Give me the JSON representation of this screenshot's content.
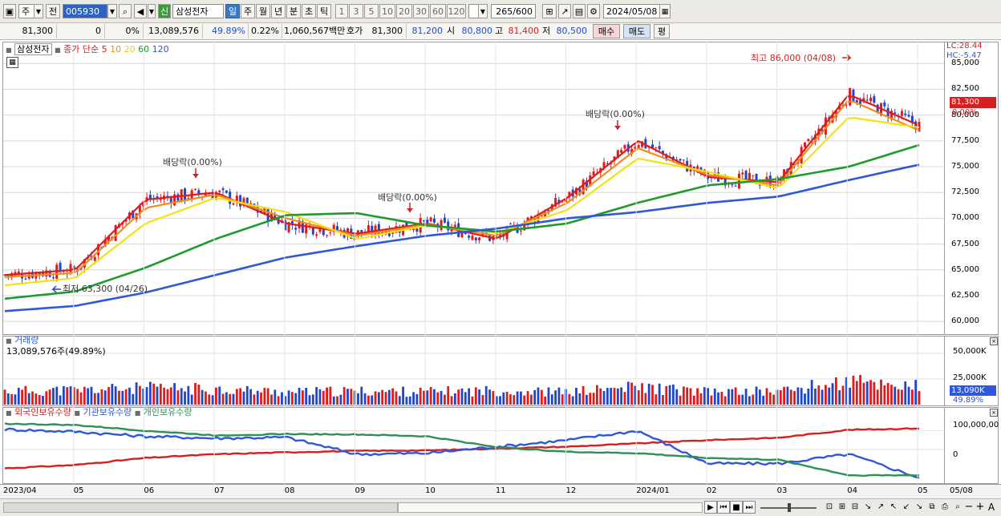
{
  "toolbar": {
    "period_type": "주",
    "prev_label": "전",
    "stock_code": "005930",
    "stock_name": "삼성전자",
    "new_badge": "신",
    "timeframes": [
      "일",
      "주",
      "월",
      "년",
      "분",
      "초",
      "틱"
    ],
    "active_timeframe": "일",
    "intervals": [
      "1",
      "3",
      "5",
      "10",
      "20",
      "30",
      "60",
      "120"
    ],
    "count_current": "265",
    "count_total": "/600",
    "date": "2024/05/08"
  },
  "quote": {
    "price": "81,300",
    "change": "0",
    "change_pct": "0%",
    "volume": "13,089,576",
    "volume_ratio": "49.89%",
    "turnover_pct": "0.22%",
    "amount": "1,060,567백만",
    "ask_label": "호가",
    "ask": "81,300",
    "bid": "81,200",
    "open_label": "시",
    "open": "80,800",
    "high_label": "고",
    "high": "81,400",
    "low_label": "저",
    "low": "80,500",
    "buy_label": "매수",
    "sell_label": "매도",
    "eval_label": "평"
  },
  "legend": {
    "title": "삼성전자",
    "indicator": "종가 단순",
    "periods": [
      {
        "label": "5",
        "color": "#e01b1b"
      },
      {
        "label": "10",
        "color": "#f08c1e"
      },
      {
        "label": "20",
        "color": "#f2e20f"
      },
      {
        "label": "60",
        "color": "#1f9a2d"
      },
      {
        "label": "120",
        "color": "#2f57d9"
      }
    ],
    "lc": "LC:28.44",
    "hc": "HC:-5.47"
  },
  "annotations": {
    "high": "최고 86,000 (04/08)",
    "low": "최저 63,300 (04/26)",
    "dividend": [
      "배당락(0.00%)",
      "배당락(0.00%)",
      "배당락(0.00%)"
    ]
  },
  "price_axis": {
    "ticks": [
      "85,000",
      "82,500",
      "80,000",
      "77,500",
      "75,000",
      "72,500",
      "70,000",
      "67,500",
      "65,000",
      "62,500",
      "60,000"
    ],
    "current_price": "81,300",
    "current_pct": "0.00%"
  },
  "volume_panel": {
    "title": "거래량",
    "value_label": "13,089,576주(49.89%)",
    "ticks": [
      "50,000K",
      "25,000K"
    ],
    "current": "13,090K",
    "current_pct": "49.89%"
  },
  "holdings_panel": {
    "series": [
      {
        "label": "외국인보유수량",
        "color": "#d42020"
      },
      {
        "label": "기관보유수량",
        "color": "#2f57d9"
      },
      {
        "label": "개인보유수량",
        "color": "#2f8f5a"
      }
    ],
    "ticks": [
      "100,000,00",
      "0"
    ]
  },
  "date_axis": [
    "2023/04",
    "05",
    "06",
    "07",
    "08",
    "09",
    "10",
    "11",
    "12",
    "2024/01",
    "02",
    "03",
    "04",
    "05",
    "05/08"
  ],
  "chart_data": [
    {
      "type": "line",
      "title": "삼성전자",
      "xlabel": "",
      "ylabel": "",
      "x": [
        "2023/04",
        "05",
        "06",
        "07",
        "08",
        "09",
        "10",
        "11",
        "12",
        "2024/01",
        "02",
        "03",
        "04",
        "05"
      ],
      "ylim": [
        59000,
        86500
      ],
      "series": [
        {
          "name": "5",
          "values": [
            64500,
            65000,
            71800,
            72500,
            69500,
            68500,
            69500,
            68000,
            72000,
            77500,
            74000,
            73500,
            82000,
            79000
          ]
        },
        {
          "name": "10",
          "values": [
            64300,
            64700,
            71000,
            72300,
            70000,
            68300,
            69400,
            68300,
            71500,
            76800,
            74200,
            73200,
            81500,
            78500
          ]
        },
        {
          "name": "20",
          "values": [
            63500,
            64200,
            69500,
            72000,
            70600,
            68000,
            69300,
            68600,
            70800,
            75800,
            74500,
            72900,
            79800,
            78800
          ]
        },
        {
          "name": "60",
          "values": [
            62200,
            62900,
            65200,
            68000,
            70300,
            70500,
            69300,
            68700,
            69500,
            71500,
            73200,
            73800,
            75000,
            77100
          ]
        },
        {
          "name": "120",
          "values": [
            61000,
            61500,
            62800,
            64500,
            66200,
            67300,
            68300,
            69000,
            70000,
            70600,
            71500,
            72100,
            73700,
            75200
          ]
        }
      ],
      "annotations": {
        "high": 86000,
        "low": 63300
      }
    },
    {
      "type": "bar",
      "title": "거래량",
      "xlabel": "",
      "ylabel": "",
      "x": [
        "2023/04",
        "05",
        "06",
        "07",
        "08",
        "09",
        "10",
        "11",
        "12",
        "2024/01",
        "02",
        "03",
        "04",
        "05"
      ],
      "ylim": [
        0,
        60000
      ],
      "series": [
        {
          "name": "거래량",
          "values": [
            13000,
            14000,
            16000,
            15000,
            12000,
            13000,
            12500,
            13500,
            12000,
            17000,
            12000,
            13000,
            22000,
            18000
          ]
        }
      ],
      "last_value": 13090
    },
    {
      "type": "line",
      "title": "",
      "xlabel": "",
      "ylabel": "",
      "x": [
        "2023/04",
        "05",
        "06",
        "07",
        "08",
        "09",
        "10",
        "11",
        "12",
        "2024/01",
        "02",
        "03",
        "04",
        "05"
      ],
      "series": [
        {
          "name": "외국인보유수량",
          "values": [
            -40,
            -33,
            -18,
            -10,
            -6,
            -3,
            -2,
            2,
            6,
            13,
            20,
            25,
            42,
            45
          ]
        },
        {
          "name": "기관보유수량",
          "values": [
            43,
            38,
            28,
            24,
            26,
            -10,
            -8,
            6,
            20,
            40,
            -30,
            -30,
            -10,
            -60
          ]
        },
        {
          "name": "개인보유수량",
          "values": [
            55,
            52,
            40,
            30,
            33,
            32,
            28,
            5,
            -5,
            -8,
            -18,
            -22,
            -55,
            -55
          ]
        }
      ],
      "ytick_labels": [
        "100,000,00",
        "0"
      ]
    }
  ]
}
